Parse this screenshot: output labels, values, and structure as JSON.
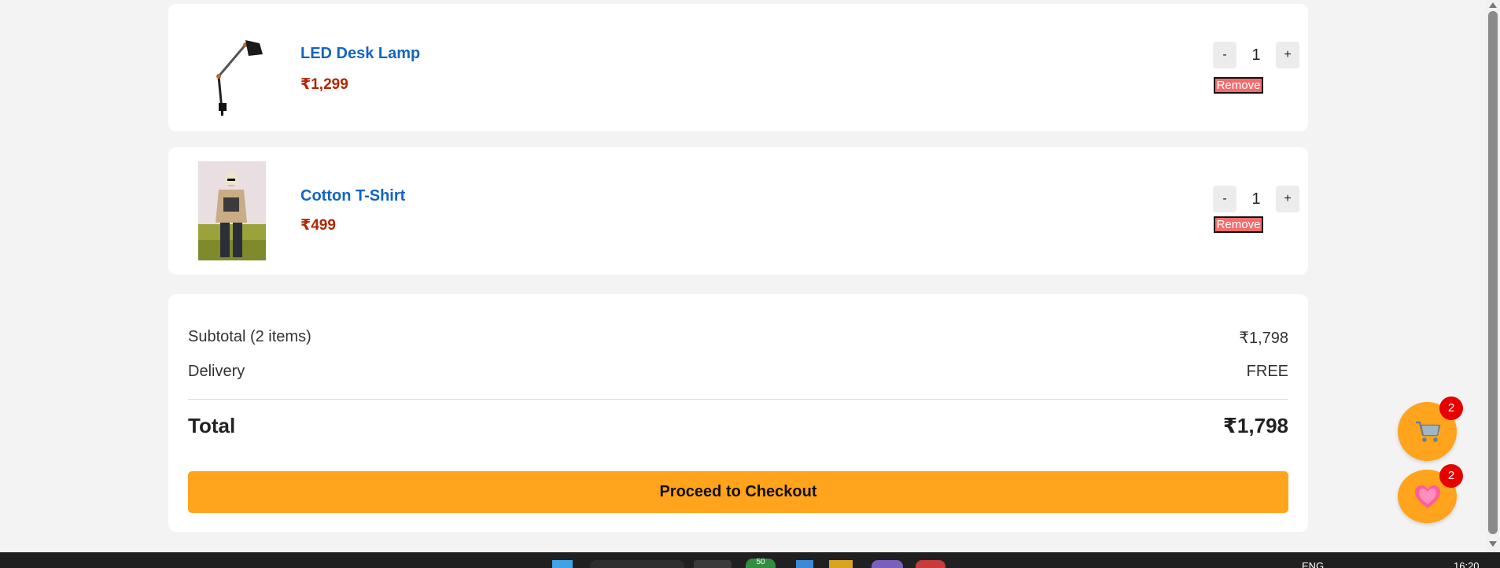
{
  "cart": {
    "items": [
      {
        "name": "LED Desk Lamp",
        "price": "₹1,299",
        "quantity": "1",
        "minus_label": "-",
        "plus_label": "+",
        "remove_label": "Remove"
      },
      {
        "name": "Cotton T-Shirt",
        "price": "₹499",
        "quantity": "1",
        "minus_label": "-",
        "plus_label": "+",
        "remove_label": "Remove"
      }
    ]
  },
  "summary": {
    "subtotal_label": "Subtotal (2 items)",
    "subtotal_value": "₹1,798",
    "delivery_label": "Delivery",
    "delivery_value": "FREE",
    "total_label": "Total",
    "total_value": "₹1,798",
    "checkout_label": "Proceed to Checkout"
  },
  "floating": {
    "cart_icon": "cart-icon",
    "cart_count": "2",
    "wishlist_icon": "heart-icon",
    "wishlist_count": "2"
  },
  "taskbar": {
    "language": "ENG",
    "time": "16:20",
    "badge_count": "50"
  },
  "colors": {
    "accent": "#ffa41c",
    "link": "#1565c0",
    "price": "#b12704",
    "remove": "#f26d6d",
    "badge": "#e60000"
  }
}
